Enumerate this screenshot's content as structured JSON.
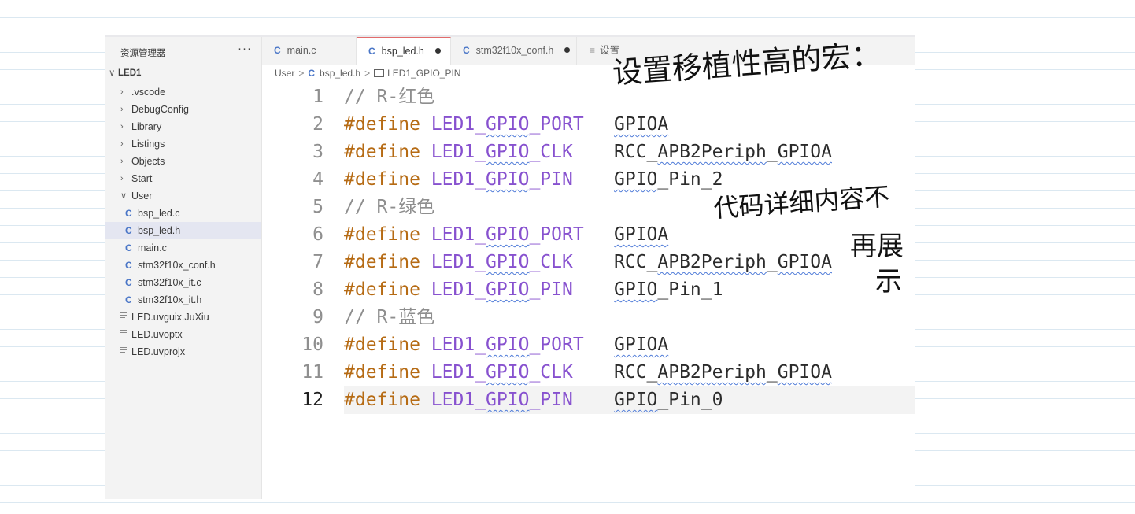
{
  "explorer": {
    "title": "资源管理器",
    "more": "···",
    "root": "LED1",
    "items": [
      {
        "label": ".vscode",
        "kind": "folder",
        "level": 1,
        "expanded": false
      },
      {
        "label": "DebugConfig",
        "kind": "folder",
        "level": 1,
        "expanded": false
      },
      {
        "label": "Library",
        "kind": "folder",
        "level": 1,
        "expanded": false
      },
      {
        "label": "Listings",
        "kind": "folder",
        "level": 1,
        "expanded": false
      },
      {
        "label": "Objects",
        "kind": "folder",
        "level": 1,
        "expanded": false
      },
      {
        "label": "Start",
        "kind": "folder",
        "level": 1,
        "expanded": false
      },
      {
        "label": "User",
        "kind": "folder",
        "level": 1,
        "expanded": true
      },
      {
        "label": "bsp_led.c",
        "kind": "c-file",
        "level": 2
      },
      {
        "label": "bsp_led.h",
        "kind": "c-file",
        "level": 2,
        "selected": true
      },
      {
        "label": "main.c",
        "kind": "c-file",
        "level": 2
      },
      {
        "label": "stm32f10x_conf.h",
        "kind": "c-file",
        "level": 2
      },
      {
        "label": "stm32f10x_it.c",
        "kind": "c-file",
        "level": 2
      },
      {
        "label": "stm32f10x_it.h",
        "kind": "c-file",
        "level": 2
      },
      {
        "label": "LED.uvguix.JuXiu",
        "kind": "file",
        "level": 1
      },
      {
        "label": "LED.uvoptx",
        "kind": "file",
        "level": 1
      },
      {
        "label": "LED.uvprojx",
        "kind": "file",
        "level": 1
      }
    ]
  },
  "tabs": [
    {
      "label": "main.c",
      "icon": "C",
      "active": false,
      "modified": false
    },
    {
      "label": "bsp_led.h",
      "icon": "C",
      "active": true,
      "modified": true
    },
    {
      "label": "stm32f10x_conf.h",
      "icon": "C",
      "active": false,
      "modified": true
    },
    {
      "label": "设置",
      "icon": "≡",
      "active": false,
      "modified": false
    }
  ],
  "breadcrumb": {
    "folder": "User",
    "file": "bsp_led.h",
    "symbol": "LED1_GPIO_PIN"
  },
  "code": {
    "current_line": 12,
    "lines": [
      {
        "n": "1",
        "comment": "// R-红色"
      },
      {
        "n": "2",
        "kw": "#define",
        "macro": "LED1_GPIO_PORT",
        "value": "GPIOA"
      },
      {
        "n": "3",
        "kw": "#define",
        "macro": "LED1_GPIO_CLK",
        "value": "RCC_APB2Periph_GPIOA"
      },
      {
        "n": "4",
        "kw": "#define",
        "macro": "LED1_GPIO_PIN",
        "value": "GPIO_Pin_2"
      },
      {
        "n": "5",
        "comment": "// R-绿色"
      },
      {
        "n": "6",
        "kw": "#define",
        "macro": "LED1_GPIO_PORT",
        "value": "GPIOA"
      },
      {
        "n": "7",
        "kw": "#define",
        "macro": "LED1_GPIO_CLK",
        "value": "RCC_APB2Periph_GPIOA"
      },
      {
        "n": "8",
        "kw": "#define",
        "macro": "LED1_GPIO_PIN",
        "value": "GPIO_Pin_1"
      },
      {
        "n": "9",
        "comment": "// R-蓝色"
      },
      {
        "n": "10",
        "kw": "#define",
        "macro": "LED1_GPIO_PORT",
        "value": "GPIOA"
      },
      {
        "n": "11",
        "kw": "#define",
        "macro": "LED1_GPIO_CLK",
        "value": "RCC_APB2Periph_GPIOA"
      },
      {
        "n": "12",
        "kw": "#define",
        "macro": "LED1_GPIO_PIN",
        "value": "GPIO_Pin_0"
      }
    ]
  },
  "annotations": {
    "top": "设置移植性高的宏：",
    "side": [
      "代码详细内容不",
      "再展",
      "示"
    ]
  },
  "colors": {
    "keyword": "#b66b14",
    "macro": "#8751cf",
    "comment": "#8e8e8e",
    "c_icon": "#4a76c7",
    "squiggle": "#4f7bd8"
  }
}
